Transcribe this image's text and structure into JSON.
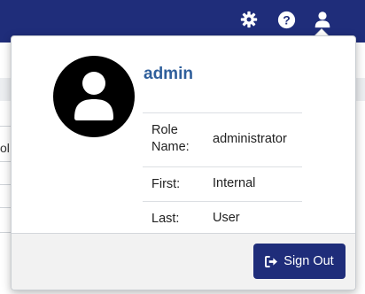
{
  "topbar": {
    "icons": [
      "gear-icon",
      "help-icon",
      "user-icon"
    ],
    "color": "#1f2d7a"
  },
  "background": {
    "partial_text": "ol"
  },
  "profile": {
    "username": "admin",
    "avatar_icon": "user-avatar-icon",
    "fields": [
      {
        "label": "Role Name:",
        "value": "administrator"
      },
      {
        "label": "First:",
        "value": "Internal"
      },
      {
        "label": "Last:",
        "value": "User"
      }
    ]
  },
  "footer": {
    "signout_label": "Sign Out",
    "signout_icon": "sign-out-icon",
    "button_color": "#1f2d7a"
  }
}
